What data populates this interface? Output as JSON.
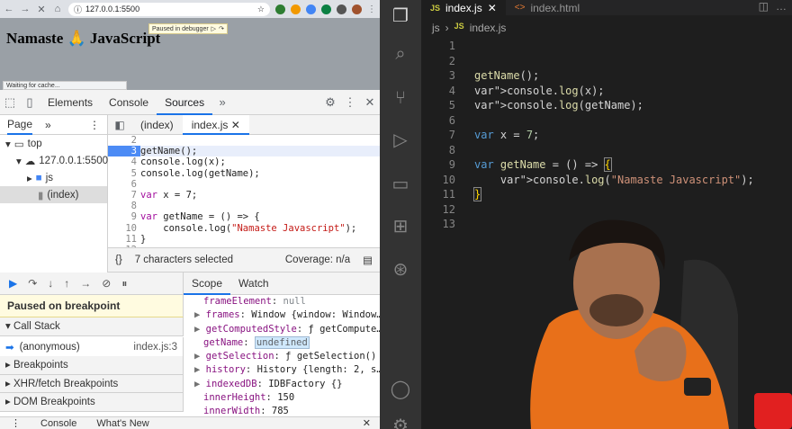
{
  "browser": {
    "address": "127.0.0.1:5500",
    "page_heading": "Namaste 🙏 JavaScript",
    "debugger_chip": "Paused in debugger",
    "status_text": "Waiting for cache..."
  },
  "devtools": {
    "tabs": [
      "Elements",
      "Console",
      "Sources"
    ],
    "active_tab": "Sources",
    "navigator": {
      "tab": "Page",
      "tree": [
        "top",
        "127.0.0.1:5500",
        "js",
        "(index)"
      ]
    },
    "editor_tabs": [
      "(index)",
      "index.js"
    ],
    "code_lines": [
      {
        "n": "2",
        "text": ""
      },
      {
        "n": "3",
        "text": "getName();"
      },
      {
        "n": "4",
        "text": "console.log(x);"
      },
      {
        "n": "5",
        "text": "console.log(getName);"
      },
      {
        "n": "6",
        "text": ""
      },
      {
        "n": "7",
        "text": "var x = 7;"
      },
      {
        "n": "8",
        "text": ""
      },
      {
        "n": "9",
        "text": "var getName = () => {"
      },
      {
        "n": "10",
        "text": "    console.log(\"Namaste Javascript\");"
      },
      {
        "n": "11",
        "text": "}"
      },
      {
        "n": "12",
        "text": ""
      }
    ],
    "breakpoint_line": "3",
    "status_left": "{}",
    "status_selection": "7 characters selected",
    "status_coverage": "Coverage: n/a",
    "paused_label": "Paused on breakpoint",
    "sections": {
      "call_stack": "Call Stack",
      "breakpoints": "Breakpoints",
      "xhr": "XHR/fetch Breakpoints",
      "dom": "DOM Breakpoints"
    },
    "call_frame": {
      "name": "(anonymous)",
      "location": "index.js:3"
    },
    "scope_tabs": [
      "Scope",
      "Watch"
    ],
    "scope_rows": [
      {
        "arrow": "",
        "key": "frameElement",
        "val": "null"
      },
      {
        "arrow": "▶",
        "key": "frames",
        "val": "Window {window: Window…"
      },
      {
        "arrow": "▶",
        "key": "getComputedStyle",
        "val": "ƒ getCompute…"
      },
      {
        "arrow": "",
        "key": "getName",
        "val": "undefined"
      },
      {
        "arrow": "▶",
        "key": "getSelection",
        "val": "ƒ getSelection()"
      },
      {
        "arrow": "▶",
        "key": "history",
        "val": "History {length: 2, s…"
      },
      {
        "arrow": "▶",
        "key": "indexedDB",
        "val": "IDBFactory {}"
      },
      {
        "arrow": "",
        "key": "innerHeight",
        "val": "150"
      },
      {
        "arrow": "",
        "key": "innerWidth",
        "val": "785"
      }
    ],
    "drawer_tabs": [
      "Console",
      "What's New"
    ]
  },
  "vscode": {
    "tabs": [
      {
        "badge": "JS",
        "label": "index.js"
      },
      {
        "badge": "<>",
        "label": "index.html"
      }
    ],
    "breadcrumb": {
      "folder": "js",
      "badge": "JS",
      "file": "index.js"
    },
    "lines": [
      "1",
      "2",
      "3",
      "4",
      "5",
      "6",
      "7",
      "8",
      "9",
      "10",
      "11",
      "12",
      "13"
    ]
  },
  "colors": {
    "accent": "#1a73e8",
    "vscode_bg": "#1e1e1e",
    "activity_bar": "#333333"
  },
  "icons": [
    "back-icon",
    "forward-icon",
    "close-icon",
    "home-icon",
    "star-icon",
    "inspect-icon",
    "device-icon",
    "gear-icon",
    "kebab-icon",
    "play-icon",
    "step-over-icon",
    "files-icon",
    "search-icon",
    "source-control-icon",
    "debug-icon",
    "extensions-icon",
    "account-icon"
  ]
}
